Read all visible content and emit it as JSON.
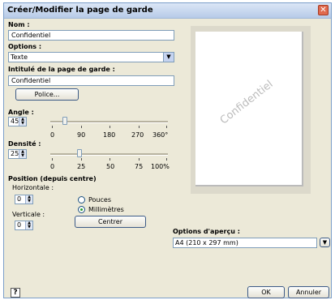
{
  "dialog": {
    "title": "Créer/Modifier la page de garde",
    "close_glyph": "✕"
  },
  "name": {
    "label": "Nom :",
    "value": "Confidentiel"
  },
  "options": {
    "label": "Options :",
    "selected": "Texte"
  },
  "cover_title": {
    "label": "Intitulé de la page de garde :",
    "value": "Confidentiel"
  },
  "font_button": "Police...",
  "angle": {
    "label": "Angle :",
    "value": "45",
    "level_fraction": 0.125,
    "scale": [
      "0",
      "90",
      "180",
      "270",
      "360°"
    ]
  },
  "density": {
    "label": "Densité :",
    "value": "25",
    "level_fraction": 0.25,
    "scale": [
      "0",
      "25",
      "50",
      "75",
      "100%"
    ]
  },
  "position": {
    "label": "Position (depuis centre)",
    "horizontal_label": "Horizontale :",
    "horizontal_value": "0",
    "vertical_label": "Verticale :",
    "vertical_value": "0",
    "units": [
      {
        "label": "Pouces",
        "selected": false
      },
      {
        "label": "Millimètres",
        "selected": true
      }
    ],
    "center_button": "Centrer"
  },
  "preview": {
    "watermark": "Confidentiel",
    "options_label": "Options d'aperçu :",
    "paper": "A4 (210 x 297 mm)"
  },
  "footer": {
    "help": "?",
    "ok": "OK",
    "cancel": "Annuler"
  },
  "icons": {
    "dropdown": "chevron-down-icon",
    "spin": "spin-arrows-icon"
  }
}
